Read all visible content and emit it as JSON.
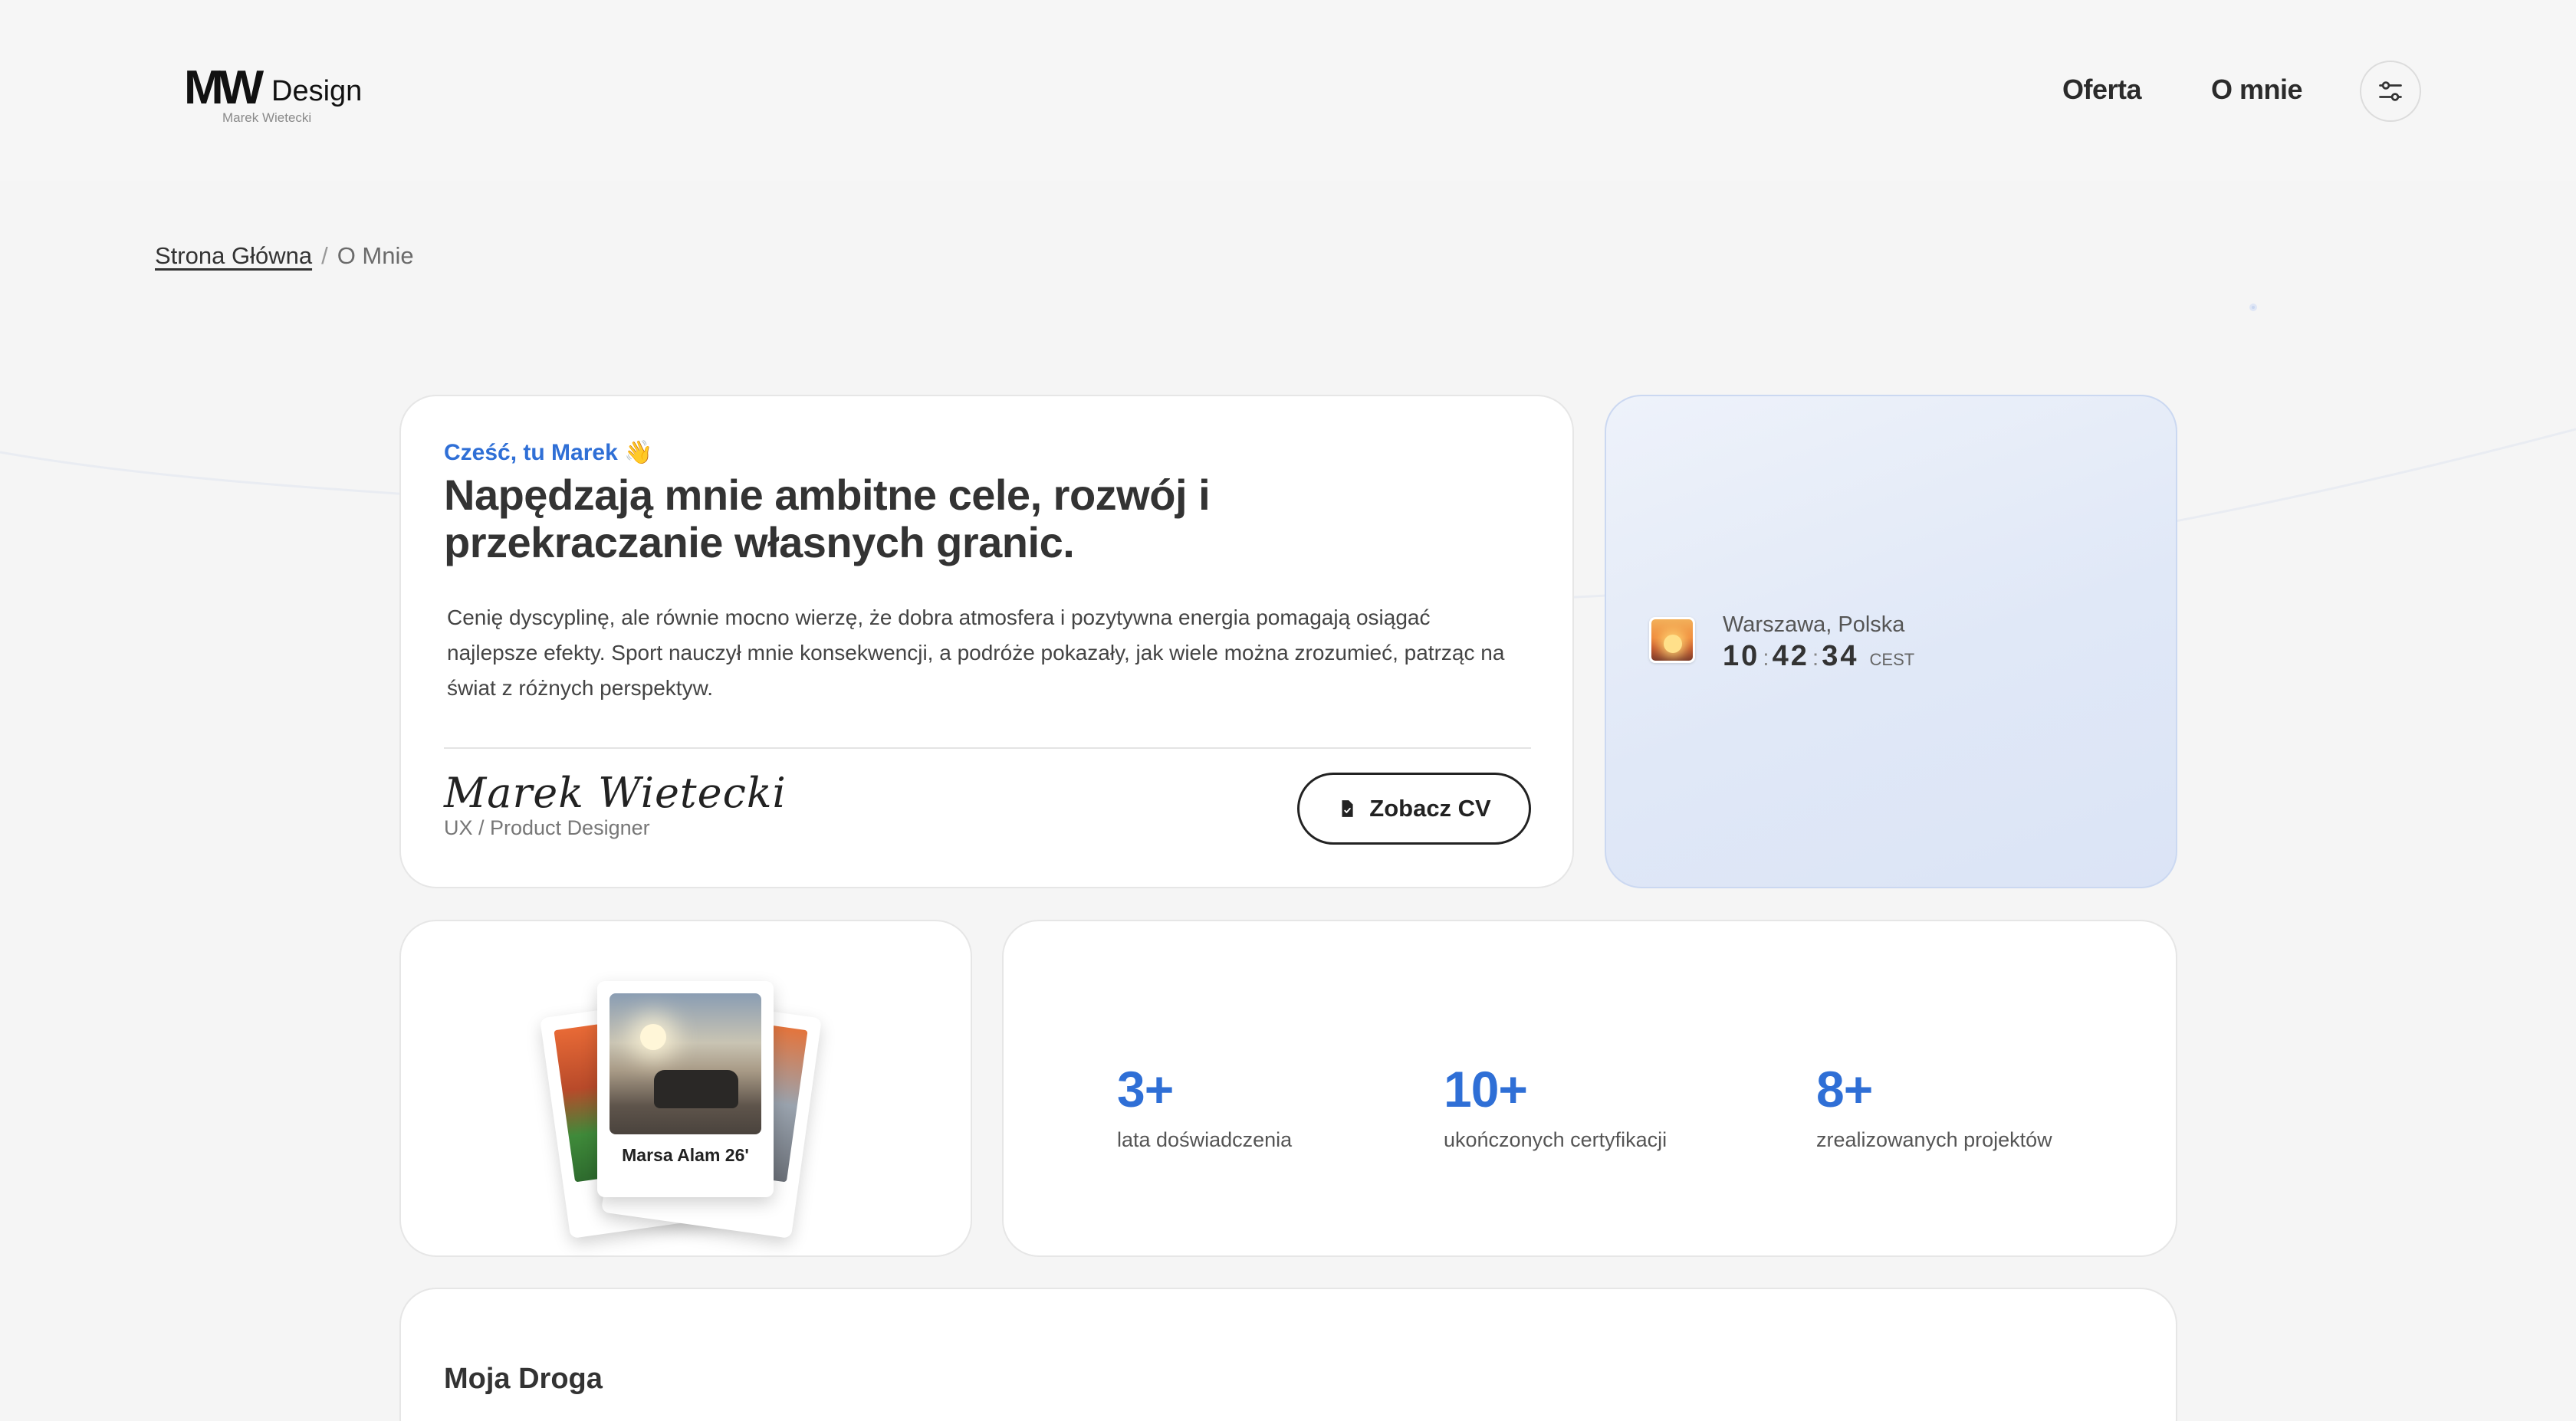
{
  "header": {
    "logo_mark": "MW",
    "logo_word": "Design",
    "logo_subtitle": "Marek Wietecki",
    "nav": [
      {
        "label": "Oferta"
      },
      {
        "label": "O mnie"
      }
    ],
    "settings_icon": "sliders-icon"
  },
  "breadcrumb": {
    "home": "Strona Główna",
    "separator": "/",
    "current": "O Mnie"
  },
  "intro": {
    "greeting": "Cześć, tu Marek 👋",
    "headline": "Napędzają mnie ambitne cele, rozwój i przekraczanie własnych granic.",
    "body": "Cenię dyscyplinę, ale równie mocno wierzę, że dobra atmosfera i pozytywna energia pomagają osiągać najlepsze efekty. Sport nauczył mnie konsekwencji, a podróże pokazały, jak wiele można zrozumieć, patrząc na świat z różnych perspektyw.",
    "signature": "Marek Wietecki",
    "role": "UX / Product Designer",
    "cv_button": "Zobacz CV"
  },
  "clock": {
    "location": "Warszawa, Polska",
    "hours": "10",
    "minutes": "42",
    "seconds": "34",
    "separator": ":",
    "timezone": "CEST"
  },
  "photos": {
    "caption": "Marsa Alam 26'"
  },
  "stats": [
    {
      "value": "3+",
      "label": "lata doświadczenia"
    },
    {
      "value": "10+",
      "label": "ukończonych certyfikacji"
    },
    {
      "value": "8+",
      "label": "zrealizowanych projektów"
    }
  ],
  "journey": {
    "title": "Moja Droga"
  },
  "colors": {
    "accent": "#2f6fd6",
    "background": "#f5f5f5",
    "clock_card": "#e0e8f7"
  }
}
